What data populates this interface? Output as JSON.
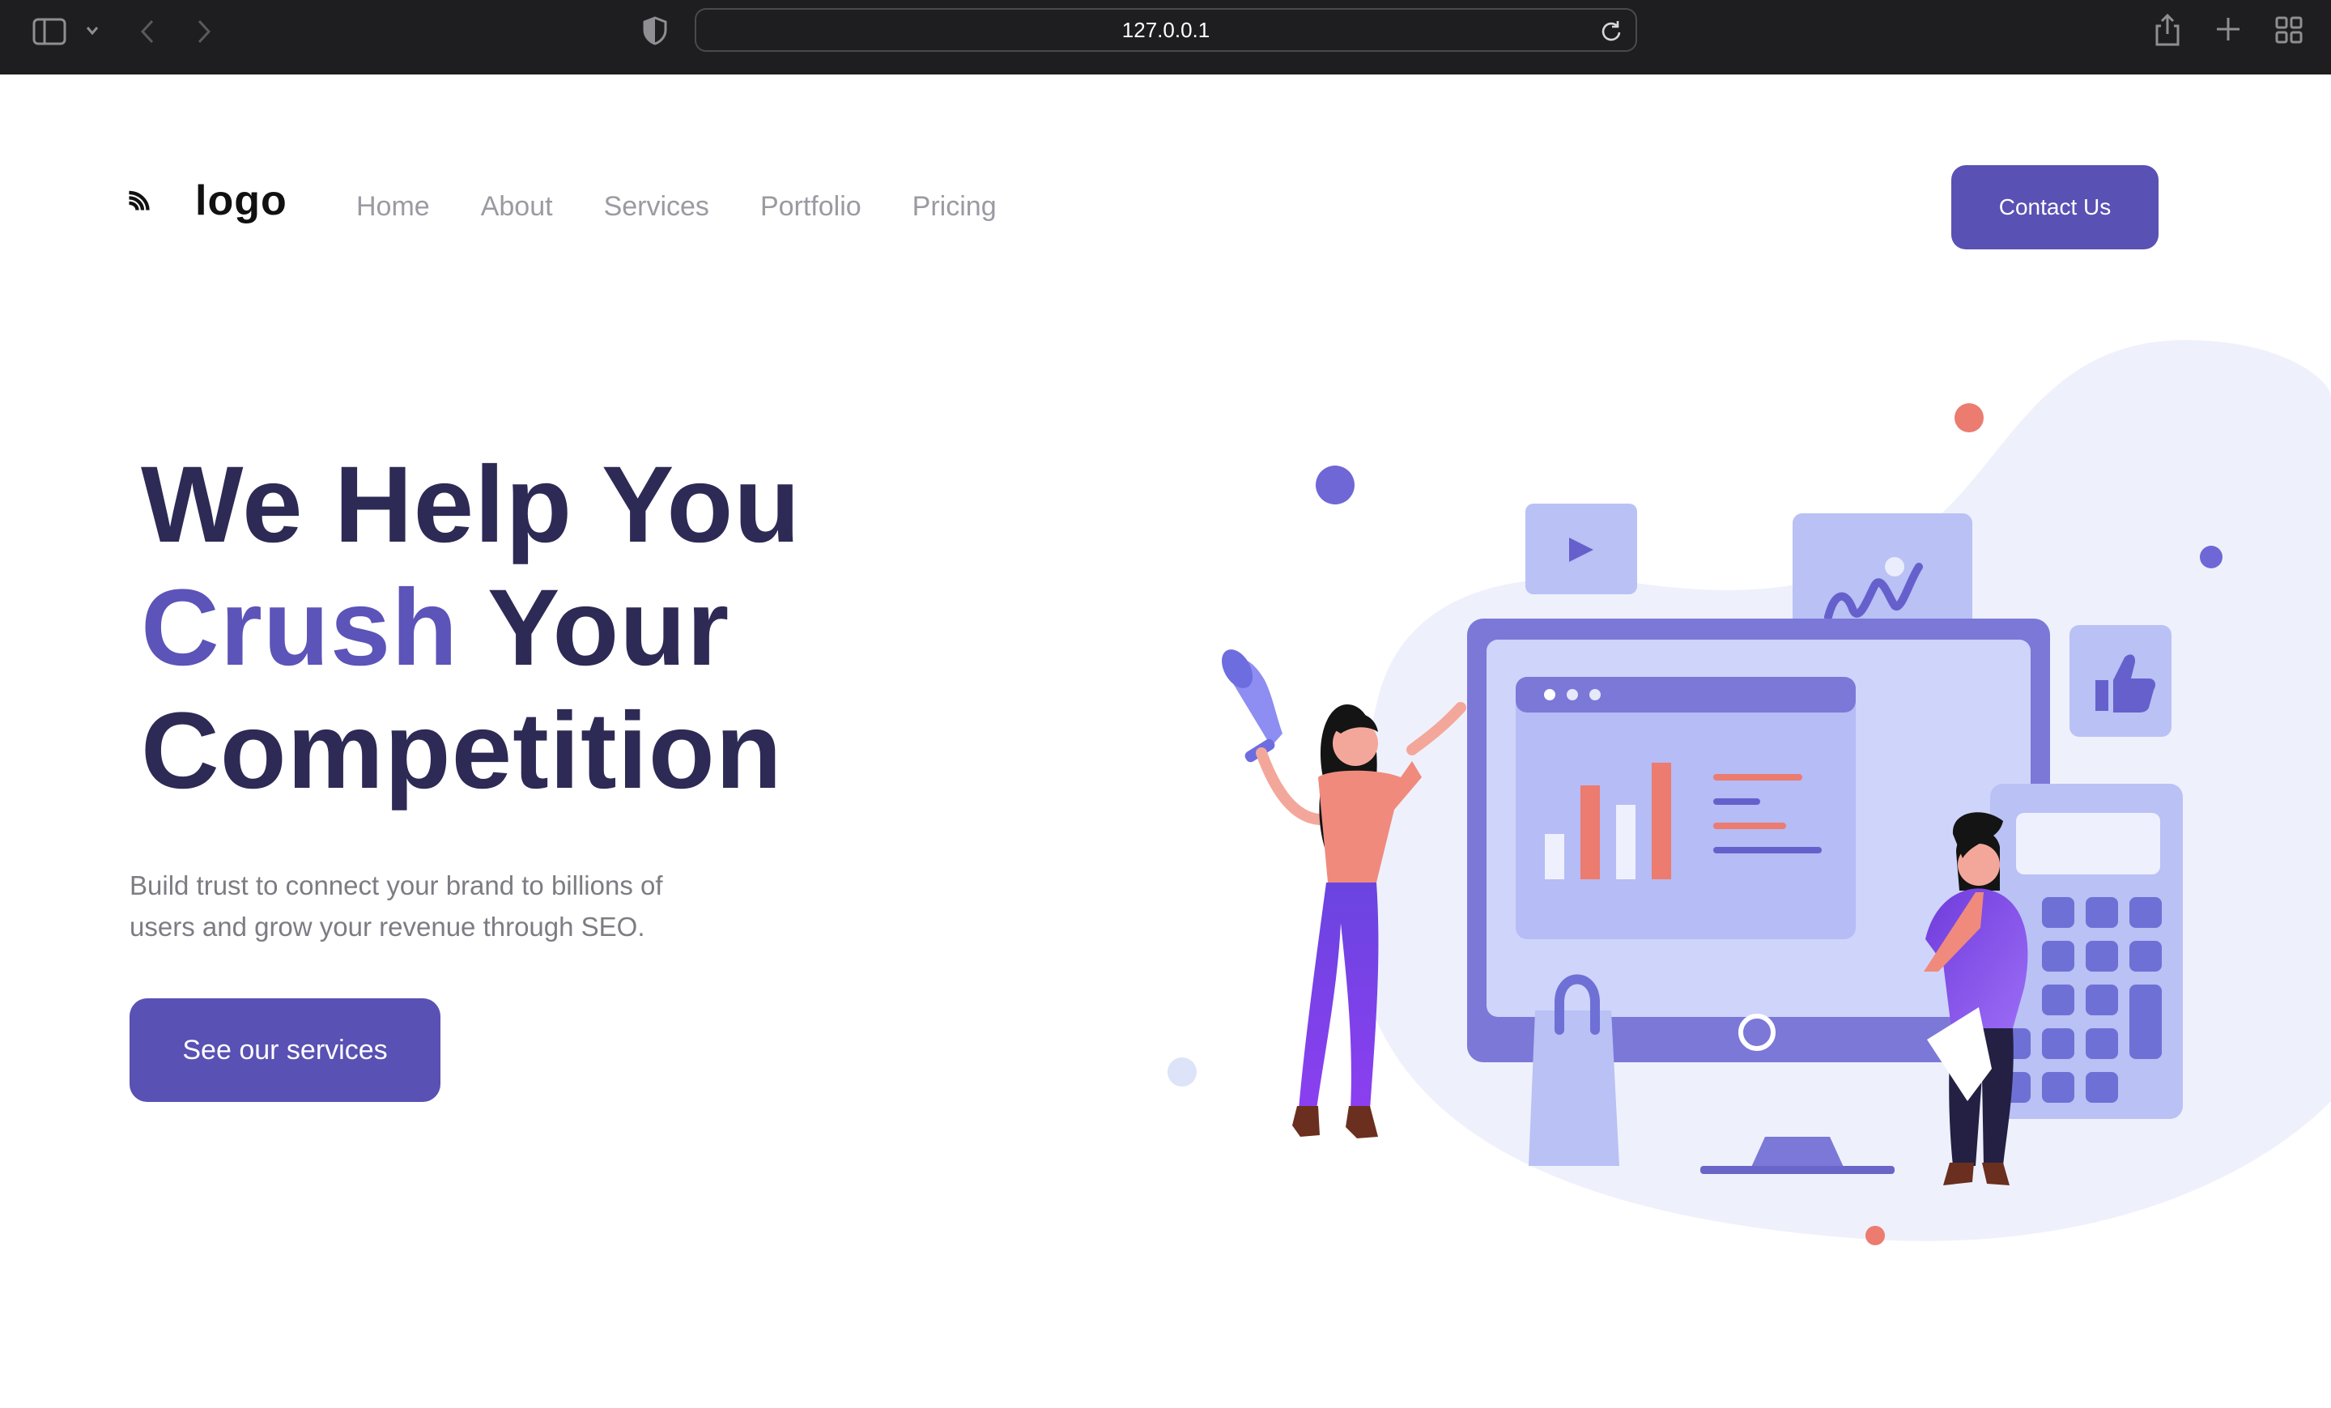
{
  "browser": {
    "url": "127.0.0.1",
    "icons": [
      "sidebar-icon",
      "chevron-down-icon",
      "back-icon",
      "forward-icon",
      "shield-icon",
      "reload-icon",
      "share-icon",
      "new-tab-icon",
      "tab-overview-icon"
    ]
  },
  "header": {
    "logo_text": "logo",
    "nav": [
      "Home",
      "About",
      "Services",
      "Portfolio",
      "Pricing"
    ],
    "contact_label": "Contact Us"
  },
  "hero": {
    "title_line1": "We Help You",
    "title_accent": "Crush",
    "title_line2_rest": " Your",
    "title_line3": "Competition",
    "subtitle_line1": "Build trust to connect your brand to billions of",
    "subtitle_line2": "users and grow your revenue through SEO.",
    "cta_label": "See our services"
  },
  "colors": {
    "brand": "#5951b3",
    "heading": "#2d2a55",
    "accent": "#5c54b8",
    "nav": "#9a9aa2",
    "illustration_blob": "#eef1fc",
    "coral": "#ec7b70"
  }
}
